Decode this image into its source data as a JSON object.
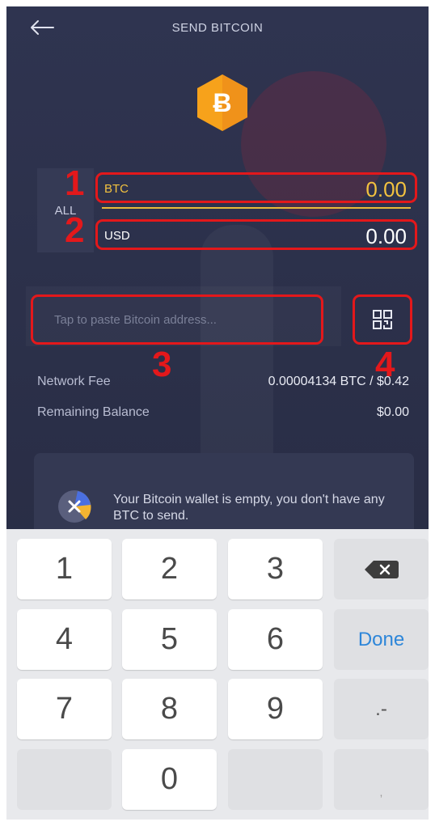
{
  "header": {
    "title": "SEND BITCOIN",
    "back_icon": "arrow-left-icon"
  },
  "coin": {
    "icon": "bitcoin-icon",
    "color": "#f7a21b"
  },
  "amounts": {
    "all_label": "ALL",
    "btc": {
      "currency": "BTC",
      "value": "0.00",
      "color": "#f2c23f"
    },
    "usd": {
      "currency": "USD",
      "value": "0.00"
    }
  },
  "address": {
    "placeholder": "Tap to paste Bitcoin address...",
    "qr_icon": "qr-scan-icon"
  },
  "annotations": {
    "m1": "1",
    "m2": "2",
    "m3": "3",
    "m4": "4",
    "color": "#e3181b"
  },
  "fees": {
    "network_fee_label": "Network Fee",
    "network_fee_value": "0.00004134 BTC / $0.42",
    "remaining_label": "Remaining Balance",
    "remaining_value": "$0.00"
  },
  "notice": {
    "text": "Your Bitcoin wallet is empty, you don't have any BTC to send.",
    "icon": "close-badge-icon"
  },
  "keypad": {
    "k1": "1",
    "k2": "2",
    "k3": "3",
    "k4": "4",
    "k5": "5",
    "k6": "6",
    "k7": "7",
    "k8": "8",
    "k9": "9",
    "k0": "0",
    "done": "Done",
    "symbol": ".-",
    "comma": ",",
    "backspace_icon": "backspace-icon"
  }
}
